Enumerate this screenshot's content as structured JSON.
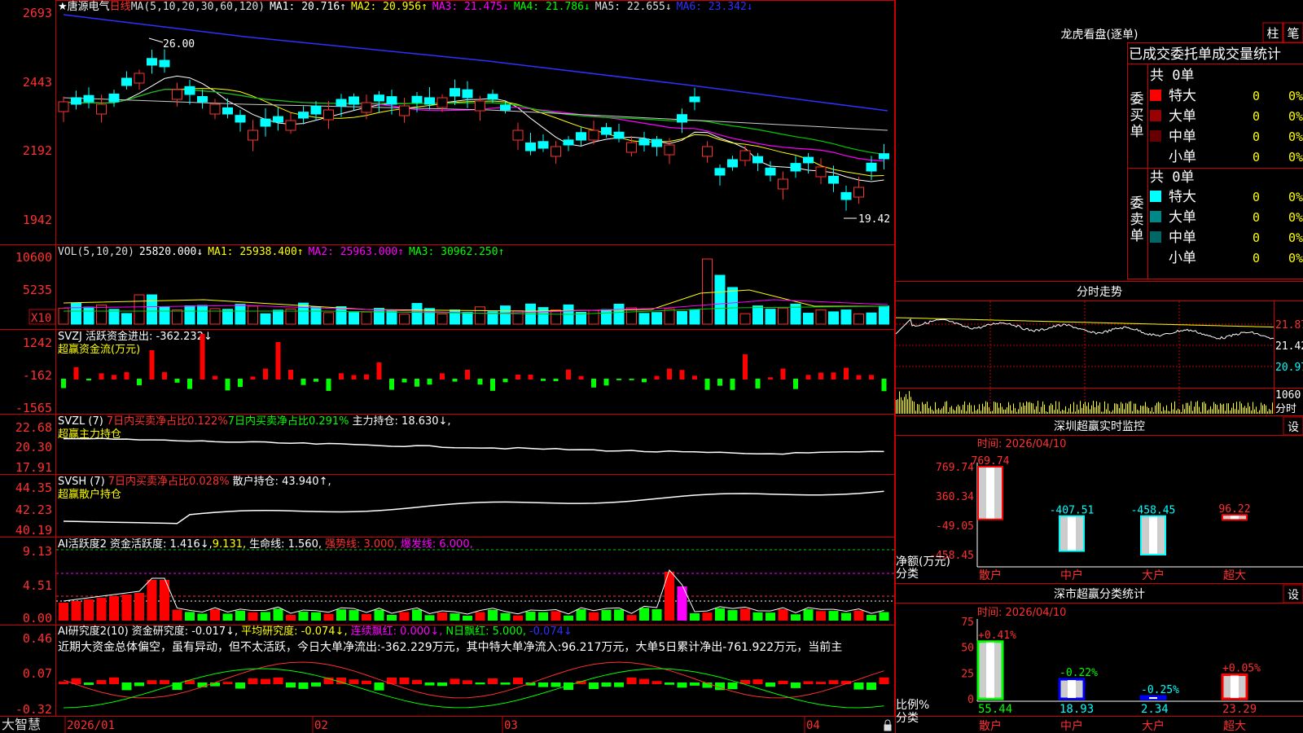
{
  "kline": {
    "star": "★",
    "stock_name": "唐源电气",
    "period": "日线",
    "ma_def": "MA(5,10,20,30,60,120)",
    "ma1": "MA1: 20.716↑",
    "ma2": "MA2: 20.956↑",
    "ma3": "MA3: 21.475↓",
    "ma4": "MA4: 21.786↓",
    "ma5": "MA5: 22.655↓",
    "ma6": "MA6: 23.342↓",
    "y_ticks": [
      "2693",
      "2443",
      "2192",
      "1942"
    ],
    "high_label": "26.00",
    "low_label": "19.42"
  },
  "volume": {
    "title": "VOL(5,10,20)",
    "value": "25820.000↓",
    "ma1": "MA1: 25938.400↑",
    "ma2": "MA2: 25963.000↑",
    "ma3": "MA3: 30962.250↑",
    "y_ticks": [
      "10600",
      "5235"
    ],
    "unit": "X10"
  },
  "svzj": {
    "line1": "SVZJ  活跃资金进出: -362.232↓",
    "line2": "超赢资金流(万元)",
    "y_ticks": [
      "1242",
      "-162",
      "-1565"
    ]
  },
  "svzl": {
    "name": "SVZL (7)",
    "a": "7日内买卖净占比0.122%",
    "b": "7日内买卖净占比0.291%",
    "c": "主力持仓: 18.630↓,",
    "line2": "超赢主力持仓",
    "y_ticks": [
      "22.68",
      "20.30",
      "17.91"
    ]
  },
  "svsh": {
    "name": "SVSH (7)",
    "a": "7日内买卖净占比0.028%",
    "c": "散户持仓: 43.940↑,",
    "line2": "超赢散户持仓",
    "y_ticks": [
      "44.35",
      "42.23",
      "40.19"
    ]
  },
  "active": {
    "name": "AI活跃度2",
    "a": "资金活跃度: 1.416↓,",
    "b": "9.131,",
    "c": "生命线: 1.560,",
    "d": "强势线: 3.000,",
    "e": "爆发线: 6.000,",
    "y_ticks": [
      "9.13",
      "4.51",
      "0.00"
    ]
  },
  "research": {
    "name": "AI研究度2(10)",
    "a": "资金研究度: -0.017↓,",
    "b": "平均研究度: -0.074↓,",
    "c": "连续飘红: 0.000↓,",
    "d": "N日飘红: 5.000,",
    "e": "-0.074↓",
    "comment": "近期大资金总体偏空，虽有异动，但不太活跃，今日大单净流出:-362.229万元，其中特大单净流入:96.217万元，大单5日累计净出-761.922万元，当前主",
    "y_ticks": [
      "0.46",
      "0.07",
      "-0.32"
    ]
  },
  "timeline": [
    "2026/01",
    "02",
    "03",
    "04"
  ],
  "status_bar": "大智慧",
  "right": {
    "dragon_title": "龙虎看盘(逐单)",
    "btn_bar": "柱",
    "btn_pen": "笔",
    "tabs_text": "已成交委托单成交量统计",
    "buy_group": {
      "vertical": [
        "委",
        "买",
        "单"
      ],
      "header": "共 0单",
      "rows": [
        {
          "label": "特大",
          "value": "0",
          "pct": "0%",
          "color": "#ff0000"
        },
        {
          "label": "大单",
          "value": "0",
          "pct": "0%",
          "color": "#990000"
        },
        {
          "label": "中单",
          "value": "0",
          "pct": "0%",
          "color": "#660000"
        },
        {
          "label": "小单",
          "value": "0",
          "pct": "0%",
          "color": ""
        }
      ]
    },
    "sell_group": {
      "vertical": [
        "委",
        "卖",
        "单"
      ],
      "header": "共 0单",
      "rows": [
        {
          "label": "特大",
          "value": "0",
          "pct": "0%",
          "color": "#00ffff"
        },
        {
          "label": "大单",
          "value": "0",
          "pct": "0%",
          "color": "#008888"
        },
        {
          "label": "中单",
          "value": "0",
          "pct": "0%",
          "color": "#006666"
        },
        {
          "label": "小单",
          "value": "0",
          "pct": "0%",
          "color": ""
        }
      ]
    },
    "intraday": {
      "title": "分时走势",
      "right_ticks": [
        "21.87",
        "21.42",
        "20.97"
      ],
      "vol_tick": "1060",
      "vol_unit": "分时"
    },
    "monitor": {
      "title": "深圳超赢实时监控",
      "setting": "设",
      "time": "时间: 2026/04/10",
      "y_ticks": [
        "769.74",
        "360.34",
        "-49.05",
        "-458.45"
      ],
      "axis_title": "净额(万元)",
      "axis_sub": "分类",
      "categories": [
        "散户",
        "中户",
        "大户",
        "超大"
      ],
      "values": [
        769.74,
        -407.51,
        -458.45,
        96.22
      ],
      "value_labels": [
        "769.74",
        "-407.51",
        "-458.45",
        "96.22"
      ],
      "colors": [
        "#ff0000",
        "#00ffff",
        "#00ffff",
        "#ff0000"
      ]
    },
    "classify": {
      "title": "深市超赢分类统计",
      "setting": "设",
      "time": "时间: 2026/04/10",
      "y_ticks": [
        "75",
        "50",
        "25",
        "0"
      ],
      "axis_title": "比例%",
      "axis_sub": "分类",
      "categories": [
        "散户",
        "中户",
        "大户",
        "超大"
      ],
      "values": [
        55.44,
        18.93,
        2.34,
        23.29
      ],
      "value_labels": [
        "55.44",
        "18.93",
        "2.34",
        "23.29"
      ],
      "change_labels": [
        "+0.41%",
        "-0.22%",
        "-0.25%",
        "+0.05%"
      ],
      "colors": [
        "#00ff00",
        "#0000ff",
        "#0000ff",
        "#ff0000"
      ]
    }
  }
}
